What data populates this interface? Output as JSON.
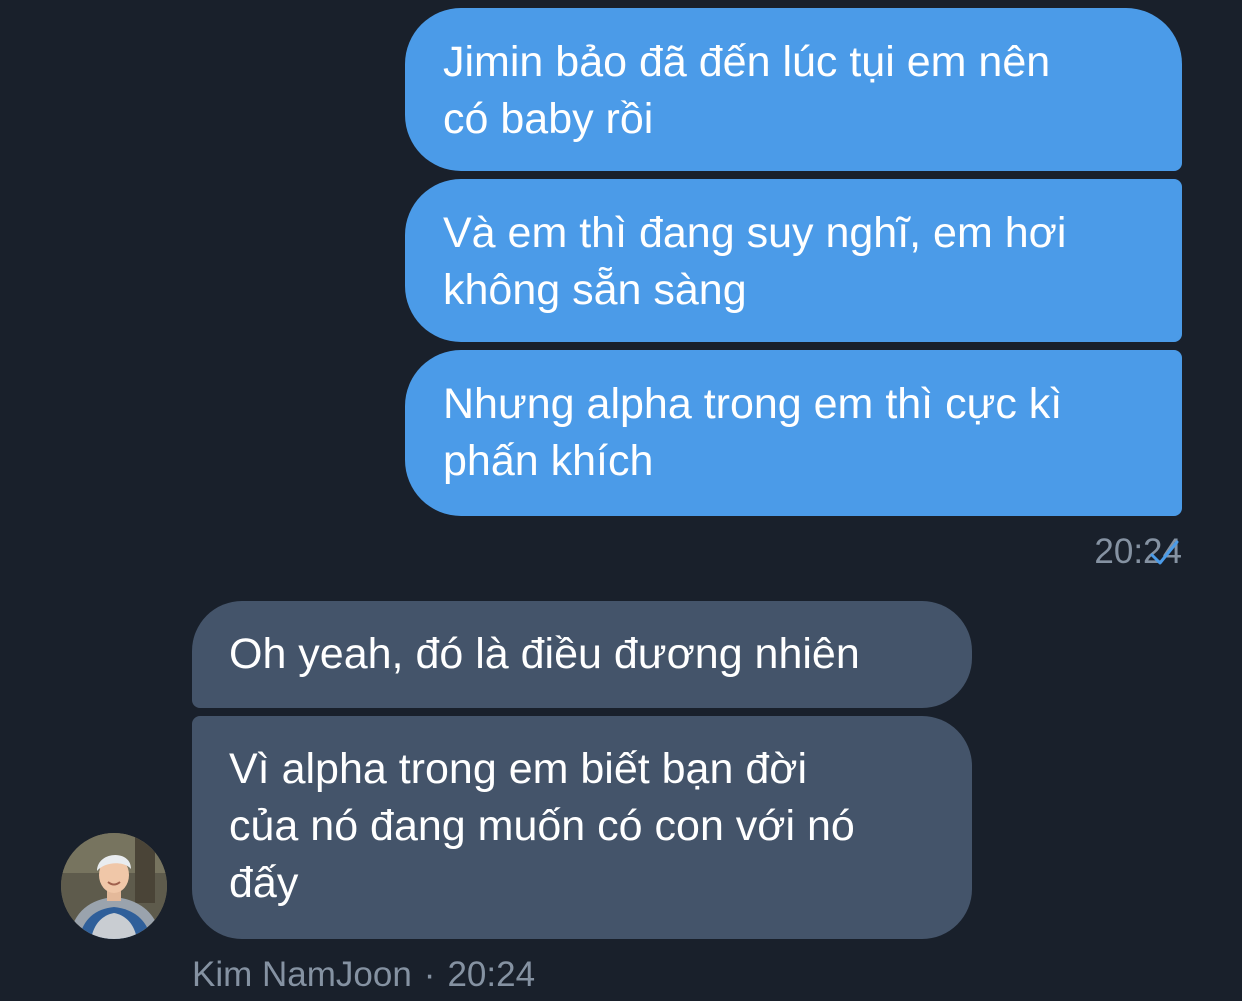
{
  "outgoing": {
    "messages": [
      "Jimin bảo đã đến lúc tụi em nên\ncó baby rồi",
      "Và em thì đang suy nghĩ, em hơi\nkhông sẵn sàng",
      "Nhưng alpha trong em thì cực kì\nphấn khích"
    ],
    "time": "20:24",
    "status_icon": "single-check-icon"
  },
  "incoming": {
    "messages": [
      "Oh yeah, đó là điều đương nhiên",
      "Vì alpha trong em biết bạn đời\ncủa nó đang muốn có con với nó\nđấy"
    ],
    "sender": "Kim NamJoon",
    "separator": "·",
    "time": "20:24",
    "avatar_icon": "contact-avatar"
  },
  "colors": {
    "background": "#19202b",
    "outgoing_bubble": "#4b9be8",
    "incoming_bubble": "#44546a",
    "meta_text": "#8592a2",
    "check_mark": "#4b9be8"
  }
}
